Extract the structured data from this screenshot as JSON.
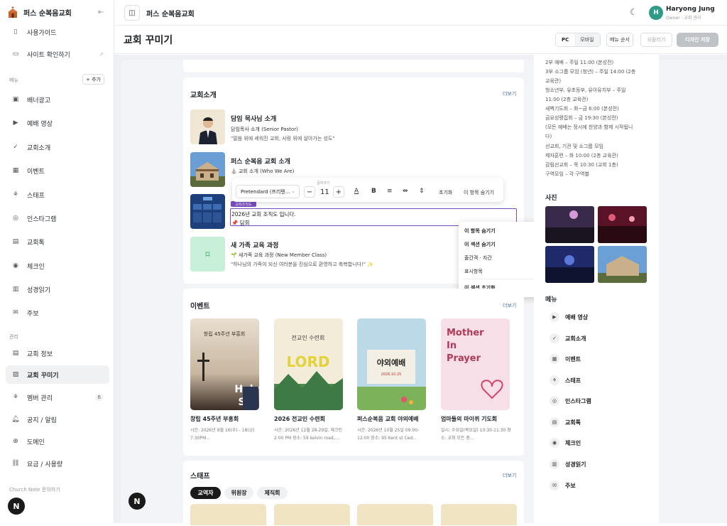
{
  "app": {
    "church_name": "퍼스 순복음교회",
    "header_title": "퍼스 순복음교회"
  },
  "user": {
    "initial": "H",
    "name": "Haryong Jung",
    "role": "Owner · 교회 관리"
  },
  "sidebar": {
    "top_items": [
      {
        "label": "사용가이드",
        "icon": "book-icon"
      },
      {
        "label": "사이트 확인하기",
        "icon": "monitor-icon"
      }
    ],
    "menu_label": "메뉴",
    "add_label": "+ 추가",
    "menu_items": [
      {
        "label": "배너광고",
        "icon": "video-icon"
      },
      {
        "label": "예배 영상",
        "icon": "youtube-icon"
      },
      {
        "label": "교회소개",
        "icon": "check-circle-icon"
      },
      {
        "label": "이벤트",
        "icon": "calendar-icon"
      },
      {
        "label": "스태프",
        "icon": "org-icon"
      },
      {
        "label": "인스타그램",
        "icon": "instagram-icon"
      },
      {
        "label": "교회톡",
        "icon": "doc-icon"
      },
      {
        "label": "체크인",
        "icon": "pin-icon"
      },
      {
        "label": "성경읽기",
        "icon": "bible-icon"
      },
      {
        "label": "주보",
        "icon": "mail-icon"
      }
    ],
    "manage_label": "관리",
    "manage_items": [
      {
        "label": "교회 정보",
        "icon": "doc-icon"
      },
      {
        "label": "교회 꾸미기",
        "icon": "image-icon"
      },
      {
        "label": "멤버 관리",
        "icon": "org-icon",
        "badge": "6"
      },
      {
        "label": "공지 / 알림",
        "icon": "bell-icon"
      },
      {
        "label": "도메인",
        "icon": "globe-icon"
      },
      {
        "label": "요금 / 사용량",
        "icon": "link-icon"
      }
    ],
    "footer_label": "Church Note 문의하기",
    "n_badge": "N"
  },
  "pagehead": {
    "title": "교회 꾸미기",
    "view_pc": "PC",
    "view_mobile": "모바일",
    "menu_order": "메뉴 순서",
    "revert": "되돌리기",
    "save": "디자인 저장"
  },
  "intro": {
    "title": "교회소개",
    "more": "더보기",
    "rows": [
      {
        "title": "담임 목사님 소개",
        "sub": "담임목사 소개 (Senior Pastor)",
        "desc": "\"말씀 위에 세워진 교회, 사랑 위에 살아가는 성도\""
      },
      {
        "title": "퍼스 순복음 교회 소개",
        "sub": "⛪ 교회 소개 (Who We Are)",
        "desc": ""
      },
      {
        "title": "",
        "sub": "",
        "desc": ""
      },
      {
        "title": "새 가족 교육 과정",
        "sub": "🌱 새가족 교육 과정 (New Member Class)",
        "desc": "\"하나님의 가족이 되신 여러분을 진심으로 환영하고 축복합니다!\" ✨"
      }
    ],
    "selected_tag": "교회조직도",
    "selected_line1": "2026년 교회 조직도 입니다.",
    "selected_line2": "📌 담회"
  },
  "toolbar": {
    "font": "Pretendard (프리텐…",
    "size_label": "글자크기",
    "size": "11",
    "reset": "초기화",
    "hide": "이 항목 숨기기"
  },
  "context_menu": {
    "items": [
      "이 항목 숨기기",
      "이 섹션 숨기기",
      "줄간격 · 자간",
      "표시항목",
      "이 섹션 초기화"
    ]
  },
  "events": {
    "title": "이벤트",
    "more": "더보기",
    "items": [
      {
        "title": "창립 45주년 부흥회",
        "desc": "시간: 2026년 9월 16(수) - 18(금) 7:30PM..."
      },
      {
        "title": "2026 전교인 수련회",
        "desc": "시간: 2026년 12월 28-29일, 체크인 2:00 PM 장소: 59 kelvin road,..."
      },
      {
        "title": "퍼스순복음 교회 야외예배",
        "desc": "시간: 2026년 10월 25일 09:00-12:00 장소: 95 Kent st Ced..."
      },
      {
        "title": "엄마들의 마이퀴 기도회",
        "desc": "일시: 수요일(목요일) 10:30-11:30 장소: 교회 모든 층..."
      }
    ]
  },
  "staff": {
    "title": "스태프",
    "more": "더보기",
    "tabs": [
      "교역자",
      "위원장",
      "제직회"
    ]
  },
  "right": {
    "schedule": [
      "2부 예배 – 주일 11:00 (본성전)",
      "3부 소그룹 모임 (청년) – 주일 14:00 (2층",
      "교육관)",
      "청소년부, 유초등부, 유아유치부 – 주일",
      "11:00 (2층 교육관)",
      "새벽기도회 – 화~금 6:00 (본성전)",
      "금요성령집회 – 금 19:30 (본성전)",
      "(모든 예배는 정시에 찬양과 함께 시작됩니",
      "다)",
      "선교회, 기관 및 소그룹 모임",
      "제자훈련 – 화 10:00 (2층 교육관)",
      "감림선교회 – 목 10:30 (교회 1층)",
      "구역모임 – 각 구역별"
    ],
    "photos_title": "사진",
    "menu_title": "메뉴",
    "menu": [
      {
        "label": "예배 영상",
        "icon": "youtube-icon"
      },
      {
        "label": "교회소개",
        "icon": "check-circle-icon"
      },
      {
        "label": "이벤트",
        "icon": "calendar-icon"
      },
      {
        "label": "스태프",
        "icon": "org-icon"
      },
      {
        "label": "인스타그램",
        "icon": "instagram-icon"
      },
      {
        "label": "교회톡",
        "icon": "doc-icon"
      },
      {
        "label": "체크인",
        "icon": "pin-icon"
      },
      {
        "label": "성경읽기",
        "icon": "bible-icon"
      },
      {
        "label": "주보",
        "icon": "mail-icon"
      }
    ]
  },
  "colors": {
    "accent": "#7a4cc2",
    "avatar": "#2e9c84",
    "mint": "#c8f0d8"
  }
}
